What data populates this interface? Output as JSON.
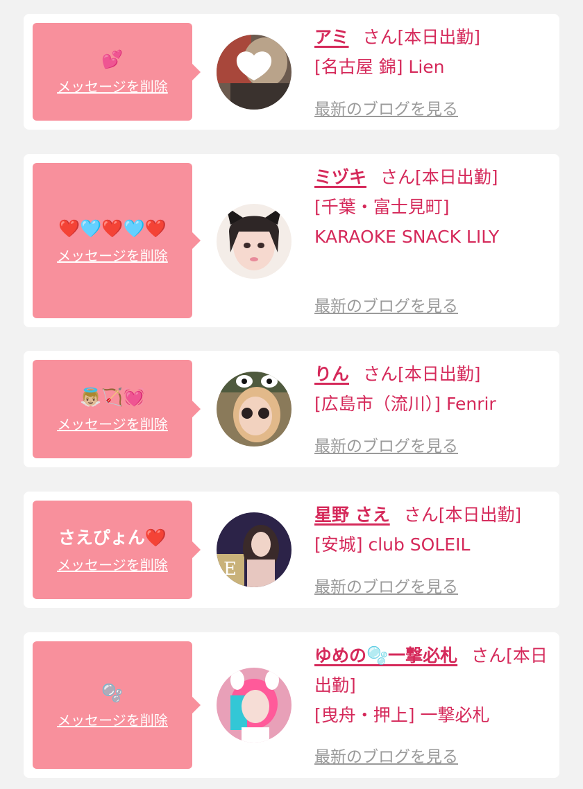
{
  "colors": {
    "page_background": "#f2f2f2",
    "card_background": "#ffffff",
    "bubble_background": "#f8909c",
    "accent_text": "#d5295a",
    "link_gray": "#9a9a9a"
  },
  "delete_label": "メッセージを削除",
  "blog_label": "最新のブログを見る",
  "cards": [
    {
      "message": "💕",
      "name": "アミ",
      "status": "さん[本日出勤]",
      "location": "[名古屋 錦] Lien",
      "avatar_icon": "profile-photo"
    },
    {
      "message": "❤️🩵❤️🩵❤️",
      "name": "ミヅキ",
      "status": "さん[本日出勤]",
      "location": "[千葉・富士見町] KARAOKE SNACK LILY",
      "avatar_icon": "profile-photo"
    },
    {
      "message": "👼🏼🏹💓",
      "name": "りん",
      "status": "さん[本日出勤]",
      "location": "[広島市（流川）] Fenrir",
      "avatar_icon": "profile-photo"
    },
    {
      "message": "さえぴょん❤️",
      "name": "星野 さえ",
      "status": "さん[本日出勤]",
      "location": "[安城] club SOLEIL",
      "avatar_icon": "profile-photo"
    },
    {
      "message": "🫧",
      "name": "ゆめの🫧一撃必札",
      "status": "さん[本日出勤]",
      "location": "[曳舟・押上] 一撃必札",
      "avatar_icon": "profile-photo"
    }
  ]
}
